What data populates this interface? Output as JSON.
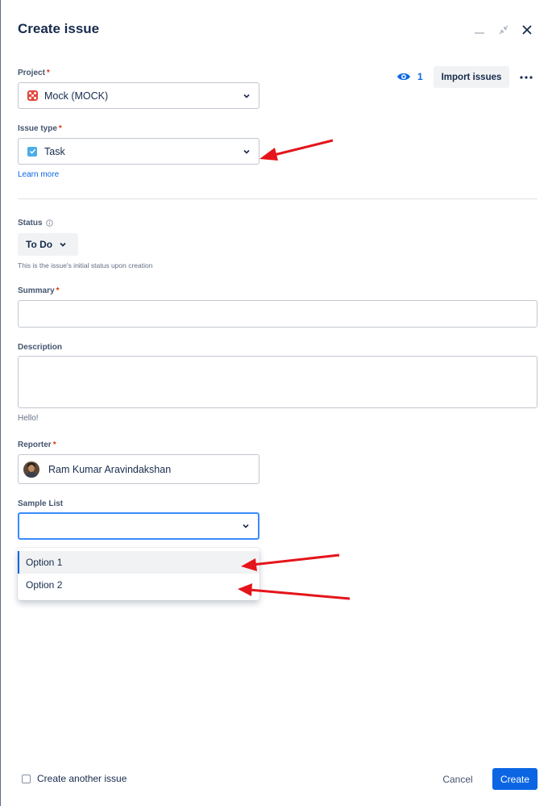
{
  "dialog": {
    "title": "Create issue"
  },
  "header": {
    "watchers_count": "1",
    "import_label": "Import issues"
  },
  "project": {
    "label": "Project",
    "required": "*",
    "value": "Mock (MOCK)"
  },
  "issue_type": {
    "label": "Issue type",
    "required": "*",
    "value": "Task",
    "learn_more": "Learn more"
  },
  "status": {
    "label": "Status",
    "value": "To Do",
    "helper": "This is the issue's initial status upon creation"
  },
  "summary": {
    "label": "Summary",
    "required": "*",
    "value": ""
  },
  "description": {
    "label": "Description",
    "value": "",
    "helper": "Hello!"
  },
  "reporter": {
    "label": "Reporter",
    "required": "*",
    "value": "Ram Kumar Aravindakshan"
  },
  "sample_list": {
    "label": "Sample List",
    "value": "",
    "options": [
      "Option 1",
      "Option 2"
    ],
    "highlighted": "Option 1"
  },
  "footer": {
    "create_another_label": "Create another issue",
    "cancel_label": "Cancel",
    "create_label": "Create"
  },
  "colors": {
    "primary": "#0c66e4",
    "required": "#de350b",
    "annotation_arrow": "#e5141b",
    "project_icon": "#e2483d",
    "task_icon": "#4bade8"
  },
  "icons": [
    "minimize-icon",
    "collapse-icon",
    "close-icon",
    "eye-icon",
    "more-icon",
    "chevron-down-icon",
    "info-icon",
    "checkbox-icon"
  ]
}
